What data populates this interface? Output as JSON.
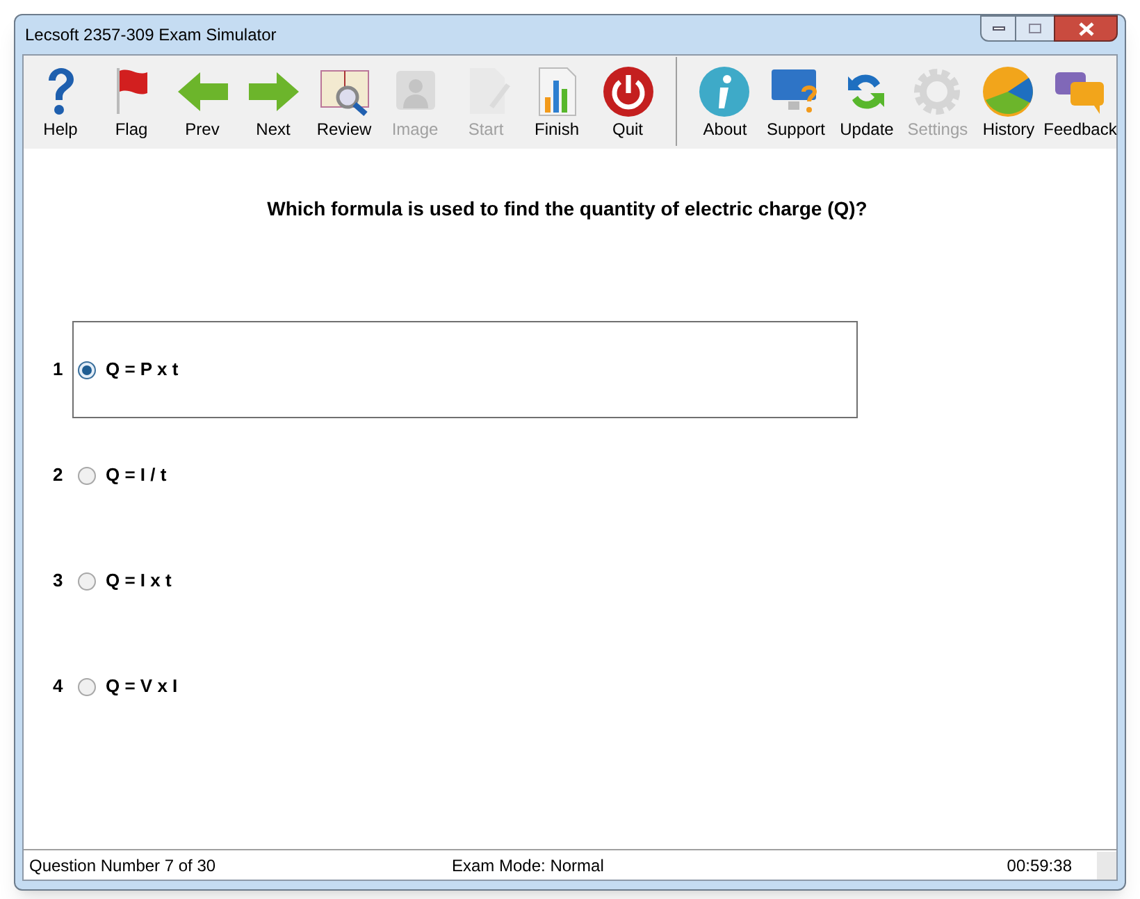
{
  "window": {
    "title": "Lecsoft 2357-309 Exam Simulator"
  },
  "toolbar_groups": [
    {
      "buttons": [
        {
          "label": "Help",
          "disabled": false
        },
        {
          "label": "Flag",
          "disabled": false
        },
        {
          "label": "Prev",
          "disabled": false
        },
        {
          "label": "Next",
          "disabled": false
        },
        {
          "label": "Review",
          "disabled": false
        },
        {
          "label": "Image",
          "disabled": true
        },
        {
          "label": "Start",
          "disabled": true
        },
        {
          "label": "Finish",
          "disabled": false
        },
        {
          "label": "Quit",
          "disabled": false
        }
      ]
    },
    {
      "buttons": [
        {
          "label": "About",
          "disabled": false
        },
        {
          "label": "Support",
          "disabled": false
        },
        {
          "label": "Update",
          "disabled": false
        },
        {
          "label": "Settings",
          "disabled": true
        },
        {
          "label": "History",
          "disabled": false
        },
        {
          "label": "Feedback",
          "disabled": false
        }
      ]
    }
  ],
  "question": "Which formula is used to find the quantity of electric charge (Q)?",
  "options": [
    {
      "number": "1",
      "label": "Q = P x t",
      "selected": true
    },
    {
      "number": "2",
      "label": "Q = I / t",
      "selected": false
    },
    {
      "number": "3",
      "label": "Q = I x t",
      "selected": false
    },
    {
      "number": "4",
      "label": "Q = V x I",
      "selected": false
    }
  ],
  "status_bar": {
    "question_number": "Question Number 7 of 30",
    "mode": "Exam Mode: Normal",
    "timer": "00:59:38"
  }
}
